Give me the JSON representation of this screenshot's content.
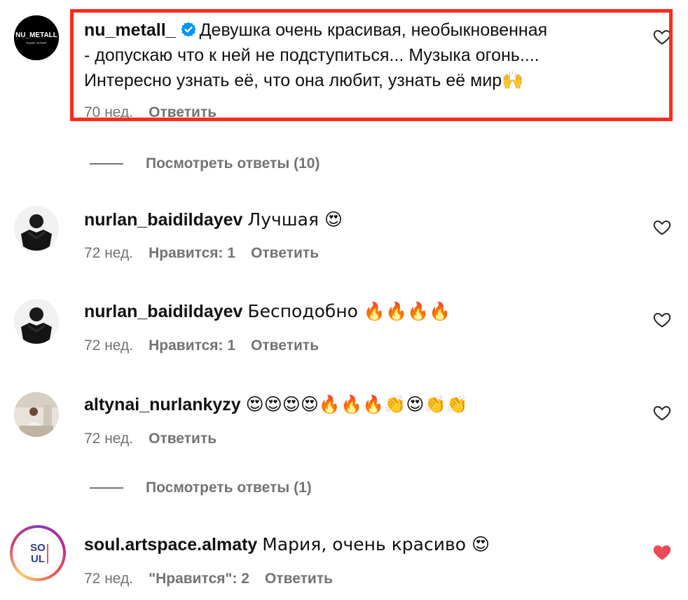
{
  "colors": {
    "highlight_border": "#ff2a1a",
    "meta_text": "#737373",
    "liked_heart": "#ed4956",
    "verified_badge": "#0095f6"
  },
  "comments": [
    {
      "username": "nu_metall_",
      "verified": true,
      "avatar_text": "NU_METALL",
      "avatar_sub": "music school",
      "lines": [
        "Девушка очень красивая, необыкновенная",
        "- допускаю что к ней не подступиться... Музыка огонь....",
        "Интересно узнать её, что она любит, узнать её мир🙌"
      ],
      "time": "70 нед.",
      "reply": "Ответить",
      "liked": false,
      "icon": "heart-outline-icon"
    },
    {
      "username": "nurlan_baidildayev",
      "text": "Лучшая 😍",
      "time": "72 нед.",
      "likes": "Нравится: 1",
      "reply": "Ответить",
      "liked": false,
      "icon": "heart-outline-icon"
    },
    {
      "username": "nurlan_baidildayev",
      "text": "Бесподобно 🔥🔥🔥🔥",
      "time": "72 нед.",
      "likes": "Нравится: 1",
      "reply": "Ответить",
      "liked": false,
      "icon": "heart-outline-icon"
    },
    {
      "username": "altynai_nurlankyzy",
      "text": "😍😍😍😍🔥🔥🔥👏😍👏👏",
      "time": "72 нед.",
      "reply": "Ответить",
      "liked": false,
      "icon": "heart-outline-icon"
    },
    {
      "username": "soul.artspace.almaty",
      "avatar_text_1": "SO",
      "avatar_text_2": "UL",
      "text": "Мария, очень красиво 😍",
      "time": "72 нед.",
      "likes": "\"Нравится\": 2",
      "reply": "Ответить",
      "liked": true,
      "icon": "heart-filled-icon"
    }
  ],
  "view_replies": [
    "Посмотреть ответы (10)",
    "Посмотреть ответы (1)"
  ]
}
